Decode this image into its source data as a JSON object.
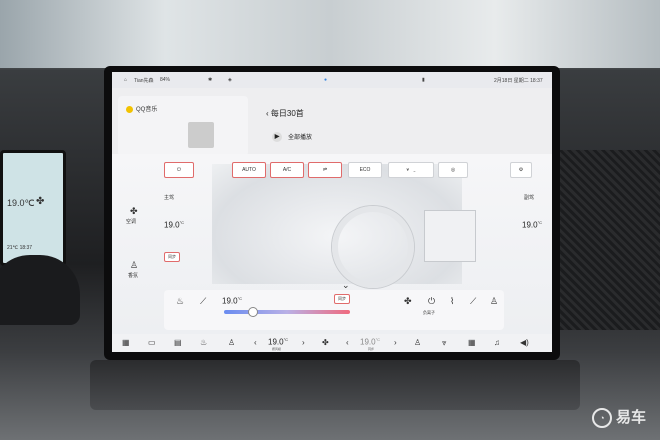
{
  "status_bar": {
    "profile": "Tian先森",
    "battery": "84%",
    "time": "2月18日 星期二 18:37"
  },
  "music": {
    "app": "QQ音乐",
    "playlist": "每日30首",
    "play_all": "全部播放"
  },
  "climate": {
    "buttons": {
      "auto": "AUTO",
      "ac": "A/C",
      "eco": "ECO"
    },
    "modes": {
      "ventilation": "空调",
      "fragrance": "香氛"
    },
    "driver": {
      "label": "主驾",
      "temp": "19.0",
      "unit": "°C"
    },
    "passenger": {
      "label": "副驾",
      "temp": "19.0",
      "unit": "°C"
    },
    "sync_label": "同步",
    "panel": {
      "temp": "19.0",
      "unit": "°C",
      "sync_label": "同步",
      "purify_label": "负离子",
      "slider_level": 0.22
    }
  },
  "dock": {
    "driver_temp": "19.0",
    "driver_unit": "°C",
    "driver_sub": "按风模",
    "passenger_temp": "19.0",
    "passenger_unit": "°C",
    "passenger_sub": "同步"
  },
  "left_cluster": {
    "temp": "19.0℃",
    "bottom": "21℃ 18:37"
  },
  "watermark": "易车",
  "colors": {
    "accent": "#e06b6b",
    "slider_cold": "#6a8cf0",
    "slider_hot": "#f06a7e"
  }
}
